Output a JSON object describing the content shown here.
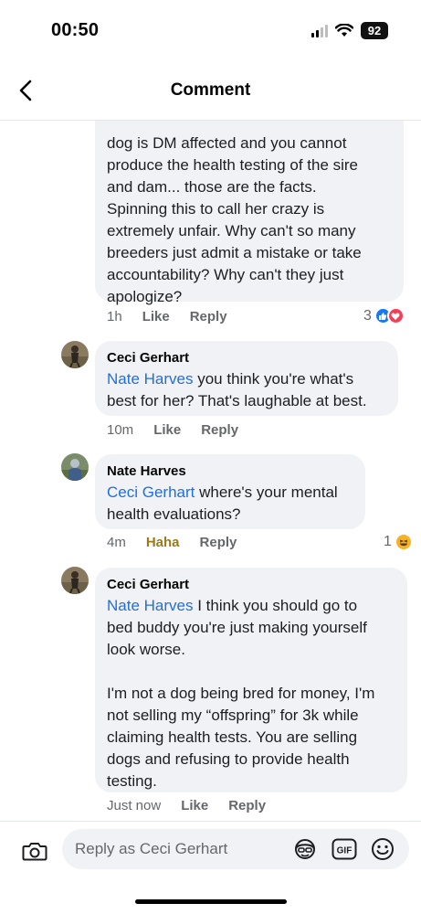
{
  "status": {
    "time": "00:50",
    "battery": "92"
  },
  "header": {
    "title": "Comment"
  },
  "comments": [
    {
      "text_lines": [
        "dog is DM affected and you cannot",
        "produce the health testing of the sire",
        "and dam... those are the facts.",
        "Spinning this to call her crazy is",
        "extremely unfair. Why can't so many",
        "breeders just admit a mistake or take",
        "accountability? Why can't they just",
        "apologize?"
      ],
      "time": "1h",
      "like": "Like",
      "reply": "Reply",
      "reaction_count": "3"
    },
    {
      "author": "Ceci Gerhart",
      "mention": "Nate Harves",
      "text_first": " you think you're what's",
      "text_rest": [
        "best for her? That's laughable at best."
      ],
      "time": "10m",
      "like": "Like",
      "reply": "Reply"
    },
    {
      "author": "Nate Harves",
      "mention": "Ceci Gerhart",
      "text_first": " where's your mental",
      "text_rest": [
        "health evaluations?"
      ],
      "time": "4m",
      "like": "Haha",
      "reply": "Reply",
      "reaction_count": "1"
    },
    {
      "author": "Ceci Gerhart",
      "mention": "Nate Harves",
      "text_first": " I think you should go to",
      "text_rest": [
        "bed buddy you're just making yourself",
        "look worse.",
        "",
        "I'm not a dog being bred for money, I'm",
        "not selling my “offspring” for 3k while",
        "claiming health tests. You are selling",
        "dogs and refusing to provide health",
        "testing."
      ],
      "time": "Just now",
      "like": "Like",
      "reply": "Reply"
    }
  ],
  "composer": {
    "placeholder": "Reply as Ceci Gerhart",
    "icons": [
      "camera-icon",
      "avatar-sticker-icon",
      "gif-icon",
      "emoji-icon"
    ]
  },
  "colors": {
    "mention": "#216fdb",
    "bubble": "#f0f2f5",
    "meta": "#65676b",
    "haha": "#9c7a16"
  }
}
